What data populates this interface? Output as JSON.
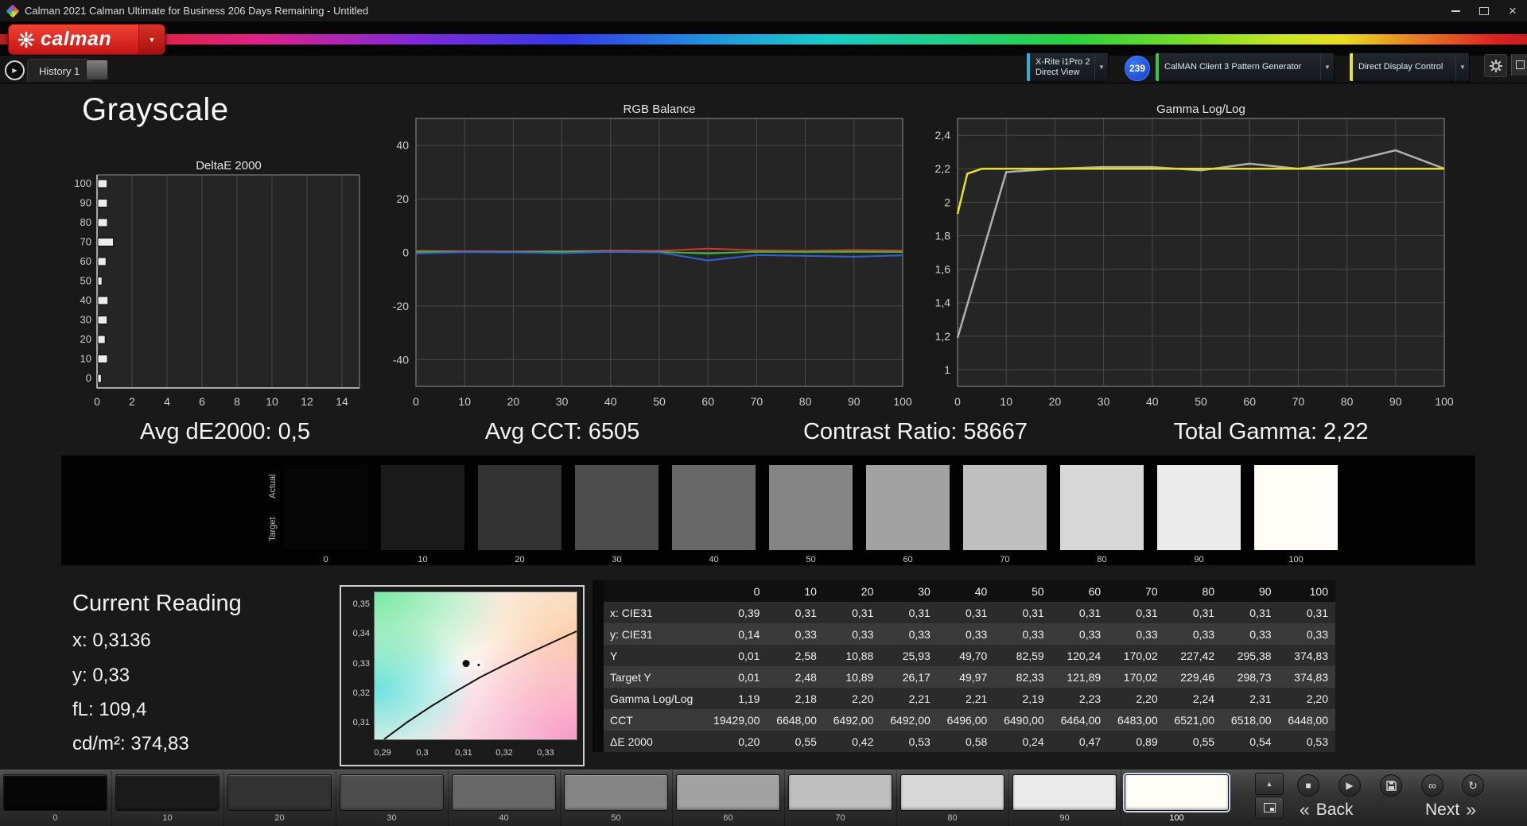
{
  "window": {
    "title": "Calman 2021 Calman Ultimate for Business 206 Days Remaining  - Untitled",
    "close_glyph": "×"
  },
  "icons": {
    "caret_down": "▼",
    "play": "▶",
    "stop": "■",
    "infinity": "∞",
    "refresh": "↻",
    "up": "▲"
  },
  "brand": {
    "logo_text": "calman"
  },
  "tabs": {
    "history_label": "History 1"
  },
  "devices": {
    "meter": {
      "line1": "X-Rite i1Pro 2",
      "line2": "Direct View",
      "accent": "#2bb3e0"
    },
    "badge": "239",
    "source": {
      "label": "CalMAN Client 3 Pattern Generator",
      "accent": "#35c942"
    },
    "display": {
      "label": "Direct Display Control",
      "accent": "#e8e435"
    }
  },
  "page": {
    "title": "Grayscale"
  },
  "stats": {
    "avg_de": "Avg dE2000: 0,5",
    "avg_cct": "Avg CCT: 6505",
    "contrast": "Contrast Ratio: 58667",
    "total_gamma": "Total Gamma: 2,22"
  },
  "current_reading": {
    "title": "Current Reading",
    "lines": [
      "x: 0,3136",
      "y: 0,33",
      "fL: 109,4",
      "cd/m²: 374,83"
    ]
  },
  "swatches": {
    "row_labels": [
      "Actual",
      "Target"
    ],
    "levels": [
      {
        "label": "0",
        "color": "#060606"
      },
      {
        "label": "10",
        "color": "#1a1a1a"
      },
      {
        "label": "20",
        "color": "#333333"
      },
      {
        "label": "30",
        "color": "#4d4d4d"
      },
      {
        "label": "40",
        "color": "#686868"
      },
      {
        "label": "50",
        "color": "#858585"
      },
      {
        "label": "60",
        "color": "#a2a2a2"
      },
      {
        "label": "70",
        "color": "#bfbfbf"
      },
      {
        "label": "80",
        "color": "#d7d7d7"
      },
      {
        "label": "90",
        "color": "#ebebeb"
      },
      {
        "label": "100",
        "color": "#fffdf6"
      }
    ]
  },
  "table": {
    "columns": [
      "0",
      "10",
      "20",
      "30",
      "40",
      "50",
      "60",
      "70",
      "80",
      "90",
      "100"
    ],
    "rows": [
      {
        "label": "x: CIE31",
        "values": [
          "0,39",
          "0,31",
          "0,31",
          "0,31",
          "0,31",
          "0,31",
          "0,31",
          "0,31",
          "0,31",
          "0,31",
          "0,31"
        ]
      },
      {
        "label": "y: CIE31",
        "values": [
          "0,14",
          "0,33",
          "0,33",
          "0,33",
          "0,33",
          "0,33",
          "0,33",
          "0,33",
          "0,33",
          "0,33",
          "0,33"
        ]
      },
      {
        "label": "Y",
        "values": [
          "0,01",
          "2,58",
          "10,88",
          "25,93",
          "49,70",
          "82,59",
          "120,24",
          "170,02",
          "227,42",
          "295,38",
          "374,83"
        ]
      },
      {
        "label": "Target Y",
        "values": [
          "0,01",
          "2,48",
          "10,89",
          "26,17",
          "49,97",
          "82,33",
          "121,89",
          "170,02",
          "229,46",
          "298,73",
          "374,83"
        ]
      },
      {
        "label": "Gamma Log/Log",
        "values": [
          "1,19",
          "2,18",
          "2,20",
          "2,21",
          "2,21",
          "2,19",
          "2,23",
          "2,20",
          "2,24",
          "2,31",
          "2,20"
        ]
      },
      {
        "label": "CCT",
        "values": [
          "19429,00",
          "6648,00",
          "6492,00",
          "6492,00",
          "6496,00",
          "6490,00",
          "6464,00",
          "6483,00",
          "6521,00",
          "6518,00",
          "6448,00"
        ]
      },
      {
        "label": "ΔE 2000",
        "values": [
          "0,20",
          "0,55",
          "0,42",
          "0,53",
          "0,58",
          "0,24",
          "0,47",
          "0,89",
          "0,55",
          "0,54",
          "0,53"
        ]
      }
    ]
  },
  "chart_data": [
    {
      "name": "deltae2000",
      "type": "bar",
      "title": "DeltaE 2000",
      "orientation": "horizontal",
      "categories": [
        0,
        10,
        20,
        30,
        40,
        50,
        60,
        70,
        80,
        90,
        100
      ],
      "values": [
        0.2,
        0.55,
        0.42,
        0.53,
        0.58,
        0.24,
        0.47,
        0.89,
        0.55,
        0.54,
        0.53
      ],
      "xlim": [
        0,
        15
      ],
      "xticks": [
        0,
        2,
        4,
        6,
        8,
        10,
        12,
        14
      ],
      "bar_color": "#ececec"
    },
    {
      "name": "rgb_balance",
      "type": "line",
      "title": "RGB Balance",
      "x": [
        0,
        10,
        20,
        30,
        40,
        50,
        60,
        70,
        80,
        90,
        100
      ],
      "xticks": [
        0,
        10,
        20,
        30,
        40,
        50,
        60,
        70,
        80,
        90,
        100
      ],
      "ylim": [
        -50,
        50
      ],
      "yticks": [
        40,
        20,
        0,
        -20,
        -40
      ],
      "series": [
        {
          "name": "red",
          "color": "#e03030",
          "values": [
            0.6,
            0.5,
            0.4,
            0.5,
            0.7,
            0.6,
            1.4,
            0.8,
            0.6,
            0.9,
            0.7
          ]
        },
        {
          "name": "green",
          "color": "#30c030",
          "values": [
            0.3,
            0.2,
            0.2,
            0.3,
            0.3,
            0.2,
            -0.4,
            0.3,
            0.2,
            0.3,
            0.2
          ]
        },
        {
          "name": "blue",
          "color": "#3060e0",
          "values": [
            -0.4,
            0.1,
            0.0,
            -0.3,
            0.2,
            0.0,
            -3.0,
            -1.0,
            -1.3,
            -1.6,
            -1.1
          ]
        }
      ]
    },
    {
      "name": "gamma_loglog",
      "type": "line",
      "title": "Gamma Log/Log",
      "xticks": [
        0,
        10,
        20,
        30,
        40,
        50,
        60,
        70,
        80,
        90,
        100
      ],
      "ylim": [
        0.9,
        2.5
      ],
      "yticks": [
        [
          2.4,
          "2,4"
        ],
        [
          2.2,
          "2,2"
        ],
        [
          2,
          "2"
        ],
        [
          1.8,
          "1,8"
        ],
        [
          1.6,
          "1,6"
        ],
        [
          1.4,
          "1,4"
        ],
        [
          1.2,
          "1,2"
        ],
        [
          1,
          "1"
        ]
      ],
      "series": [
        {
          "name": "measured",
          "color": "#b0b0b0",
          "width": 2.5,
          "x": [
            0,
            10,
            20,
            30,
            40,
            50,
            60,
            70,
            80,
            90,
            100
          ],
          "y": [
            1.19,
            2.18,
            2.2,
            2.21,
            2.21,
            2.19,
            2.23,
            2.2,
            2.24,
            2.31,
            2.2
          ]
        },
        {
          "name": "target",
          "color": "#e8e41c",
          "width": 2.5,
          "x": [
            0,
            2,
            5,
            10,
            20,
            30,
            40,
            50,
            60,
            70,
            80,
            90,
            100
          ],
          "y": [
            1.93,
            2.17,
            2.2,
            2.2,
            2.2,
            2.2,
            2.2,
            2.2,
            2.2,
            2.2,
            2.2,
            2.2,
            2.2
          ]
        }
      ]
    },
    {
      "name": "cie_xy",
      "type": "scatter",
      "xrange": [
        0.2879,
        0.3378
      ],
      "yrange": [
        0.3046,
        0.3548
      ],
      "xticks": [
        "0,29",
        "0,3",
        "0,31",
        "0,32",
        "0,33"
      ],
      "yticks": [
        "0,35",
        "0,34",
        "0,33",
        "0,32",
        "0,31"
      ],
      "locus": [
        [
          0.2902,
          0.3046
        ],
        [
          0.296,
          0.3105
        ],
        [
          0.302,
          0.316
        ],
        [
          0.308,
          0.321
        ],
        [
          0.314,
          0.3258
        ],
        [
          0.32,
          0.33
        ],
        [
          0.326,
          0.334
        ],
        [
          0.332,
          0.3378
        ],
        [
          0.3378,
          0.3415
        ]
      ],
      "ref_point": [
        0.3105,
        0.3305
      ],
      "reading_point": [
        0.3136,
        0.33
      ]
    }
  ],
  "bottom": {
    "back_label": "Back",
    "next_label": "Next",
    "back_chevron": "«",
    "next_chevron": "»",
    "patches": [
      {
        "label": "0",
        "color": "#060606",
        "selected": false
      },
      {
        "label": "10",
        "color": "#1a1a1a",
        "selected": false
      },
      {
        "label": "20",
        "color": "#333333",
        "selected": false
      },
      {
        "label": "30",
        "color": "#4d4d4d",
        "selected": false
      },
      {
        "label": "40",
        "color": "#686868",
        "selected": false
      },
      {
        "label": "50",
        "color": "#858585",
        "selected": false
      },
      {
        "label": "60",
        "color": "#a2a2a2",
        "selected": false
      },
      {
        "label": "70",
        "color": "#bfbfbf",
        "selected": false
      },
      {
        "label": "80",
        "color": "#d7d7d7",
        "selected": false
      },
      {
        "label": "90",
        "color": "#ebebeb",
        "selected": false
      },
      {
        "label": "100",
        "color": "#fffdf6",
        "selected": true
      }
    ]
  }
}
